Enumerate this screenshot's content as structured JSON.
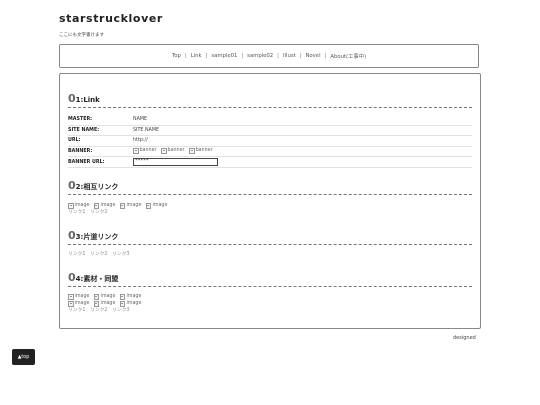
{
  "site": {
    "title": "starstrucklover",
    "tagline": "ここにも文字書けます"
  },
  "nav": {
    "items": [
      {
        "label": "Top"
      },
      {
        "label": "Link"
      },
      {
        "label": "sample01"
      },
      {
        "label": "sample02"
      },
      {
        "label": "Illust"
      },
      {
        "label": "Novel"
      },
      {
        "label": "About(工事中)"
      }
    ],
    "separator": "|"
  },
  "sections": {
    "link": {
      "num": "0",
      "title": "1:Link",
      "rows": {
        "master": {
          "label": "MASTER:",
          "value": "NAME"
        },
        "site_name": {
          "label": "SITE NAME:",
          "value": "SITE NAME"
        },
        "url": {
          "label": "URL:",
          "value": "http://"
        },
        "banner": {
          "label": "BANNER:",
          "alts": [
            "banner",
            "banner",
            "banner"
          ]
        },
        "banner_url": {
          "label": "BANNER URL:",
          "value": "*****"
        }
      }
    },
    "mutual": {
      "num": "0",
      "title": "2:相互リンク",
      "images": [
        "image",
        "image",
        "image",
        "image"
      ],
      "links": [
        "リンク1",
        "リンク2"
      ]
    },
    "oneway": {
      "num": "0",
      "title": "3:片道リンク",
      "links": [
        "リンク1",
        "リンク2",
        "リンク3"
      ]
    },
    "materials": {
      "num": "0",
      "title": "4:素材・同盟",
      "images_row1": [
        "image",
        "image",
        "image"
      ],
      "images_row2": [
        "image",
        "image",
        "image"
      ],
      "links": [
        "リンク1",
        "リンク2",
        "リンク3"
      ]
    }
  },
  "footer": {
    "credit": "designed",
    "top_label": "▲top"
  }
}
